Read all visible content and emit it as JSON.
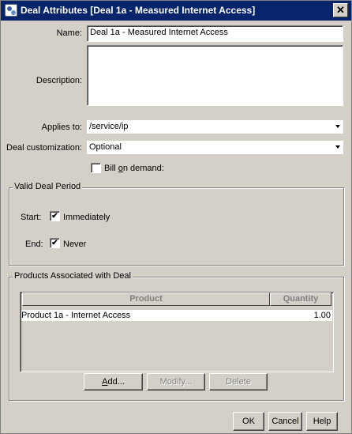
{
  "window": {
    "title": "Deal Attributes [Deal 1a - Measured Internet Access]",
    "close_glyph": "✕"
  },
  "form": {
    "name_label": "Name:",
    "name_value": "Deal 1a - Measured Internet Access",
    "description_label": "Description:",
    "description_value": "",
    "applies_to_label": "Applies to:",
    "applies_to_value": "/service/ip",
    "customization_label": "Deal customization:",
    "customization_value": "Optional",
    "bill_on_demand": {
      "label_pre": "Bill ",
      "label_ul": "o",
      "label_post": "n demand:",
      "checked": false
    }
  },
  "valid_period": {
    "title": "Valid Deal Period",
    "start_label": "Start:",
    "start_checked": true,
    "start_text": "Immediately",
    "end_label": "End:",
    "end_checked": true,
    "end_text": "Never"
  },
  "products": {
    "title": "Products Associated with Deal",
    "columns": [
      "Product",
      "Quantity"
    ],
    "rows": [
      {
        "product": "Product 1a - Internet Access",
        "quantity": "1.00"
      }
    ],
    "add_pre": "",
    "add_ul": "A",
    "add_post": "dd...",
    "modify_label": "Modify...",
    "delete_label": "Delete"
  },
  "footer": {
    "ok_label": "OK",
    "cancel_label": "Cancel",
    "help_label": "Help"
  },
  "check_glyph": "✔"
}
